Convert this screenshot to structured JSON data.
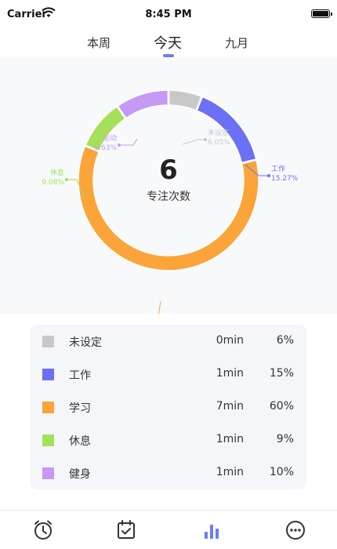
{
  "status_bar": {
    "carrier": "Carrier",
    "time": "8:45 PM"
  },
  "tabs": [
    {
      "label": "本周",
      "selected": false
    },
    {
      "label": "今天",
      "selected": true
    },
    {
      "label": "九月",
      "selected": false
    }
  ],
  "accent_color": "#6b7df5",
  "summary": {
    "count": "6",
    "label": "专注次数"
  },
  "chart_data": {
    "type": "pie",
    "variant": "donut",
    "categories": [
      "未设定",
      "工作",
      "学习",
      "休息",
      "运动"
    ],
    "values": [
      6.05,
      15.27,
      59.97,
      9.08,
      9.63
    ],
    "labels": [
      "未设定 6.05%",
      "工作 15.27%",
      "学习 59.97%",
      "休息 9.08%",
      "运动 9.63%"
    ],
    "label_names": [
      "未设定",
      "工作",
      "学习",
      "休息",
      "运动"
    ],
    "label_pcts": [
      "6.05%",
      "15.27%",
      "59.97%",
      "9.08%",
      "9.63%"
    ],
    "colors": [
      "#c8c8c8",
      "#6b70f5",
      "#faa43a",
      "#a6e05a",
      "#c49af5"
    ]
  },
  "legend": [
    {
      "name": "未设定",
      "time": "0min",
      "pct": "6%",
      "color": "#c8c8c8"
    },
    {
      "name": "工作",
      "time": "1min",
      "pct": "15%",
      "color": "#6b70f5"
    },
    {
      "name": "学习",
      "time": "7min",
      "pct": "60%",
      "color": "#faa43a"
    },
    {
      "name": "休息",
      "time": "1min",
      "pct": "9%",
      "color": "#a6e05a"
    },
    {
      "name": "健身",
      "time": "1min",
      "pct": "10%",
      "color": "#c49af5"
    }
  ],
  "tabbar": [
    {
      "icon": "alarm-clock-icon",
      "active": false
    },
    {
      "icon": "checklist-icon",
      "active": false
    },
    {
      "icon": "bar-chart-icon",
      "active": true
    },
    {
      "icon": "more-icon",
      "active": false
    }
  ]
}
